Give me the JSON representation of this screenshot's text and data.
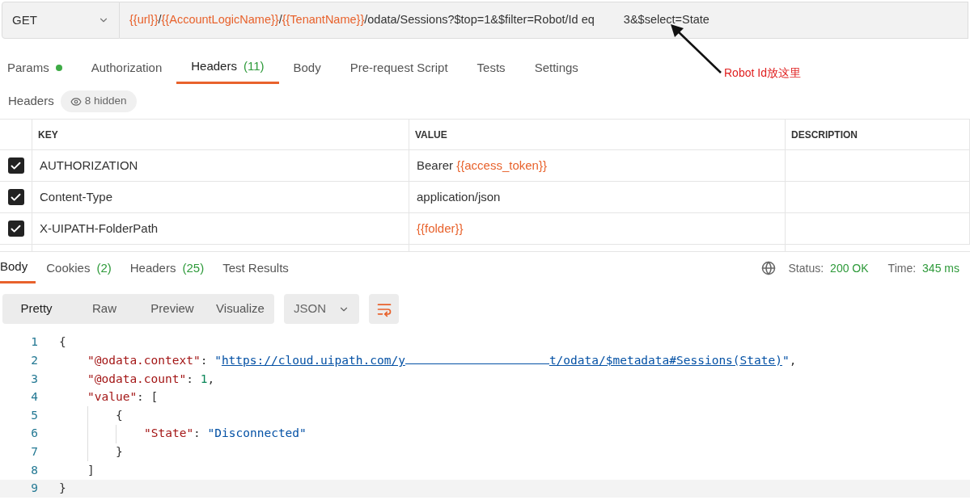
{
  "request": {
    "method": "GET",
    "url": [
      {
        "kind": "var",
        "text": "{{url}}"
      },
      {
        "kind": "text",
        "text": "/"
      },
      {
        "kind": "var",
        "text": "{{AccountLogicName}}"
      },
      {
        "kind": "text",
        "text": "/"
      },
      {
        "kind": "var",
        "text": "{{TenantName}}"
      },
      {
        "kind": "text",
        "text": "/odata/Sessions?$top=1&$filter=Robot/Id eq"
      },
      {
        "kind": "redacted"
      },
      {
        "kind": "text",
        "text": "3&$select=State"
      }
    ]
  },
  "annotation": {
    "text": "Robot Id放这里"
  },
  "request_tabs": [
    {
      "label": "Params",
      "dot": true,
      "selected": false
    },
    {
      "label": "Authorization",
      "selected": false
    },
    {
      "label": "Headers",
      "count": "(11)",
      "selected": true
    },
    {
      "label": "Body",
      "selected": false
    },
    {
      "label": "Pre-request Script",
      "selected": false
    },
    {
      "label": "Tests",
      "selected": false
    },
    {
      "label": "Settings",
      "selected": false
    }
  ],
  "headers_bar": {
    "title": "Headers",
    "hidden": "8 hidden"
  },
  "table": {
    "columns": [
      "KEY",
      "VALUE",
      "DESCRIPTION"
    ],
    "rows": [
      {
        "checked": true,
        "key": "AUTHORIZATION",
        "value": [
          {
            "kind": "text",
            "text": "Bearer "
          },
          {
            "kind": "var",
            "text": "{{access_token}}"
          }
        ]
      },
      {
        "checked": true,
        "key": "Content-Type",
        "value": [
          {
            "kind": "text",
            "text": "application/json"
          }
        ]
      },
      {
        "checked": true,
        "key": "X-UIPATH-FolderPath",
        "value": [
          {
            "kind": "var",
            "text": "{{folder}}"
          }
        ]
      }
    ]
  },
  "response_tabs": [
    {
      "label": "Body",
      "selected": true
    },
    {
      "label": "Cookies",
      "count": "(2)",
      "selected": false
    },
    {
      "label": "Headers",
      "count": "(25)",
      "selected": false
    },
    {
      "label": "Test Results",
      "selected": false
    }
  ],
  "status": {
    "status_label": "Status:",
    "status": "200 OK",
    "time_label": "Time:",
    "time": "345 ms"
  },
  "view_modes": [
    {
      "label": "Pretty",
      "selected": true
    },
    {
      "label": "Raw",
      "selected": false
    },
    {
      "label": "Preview",
      "selected": false
    },
    {
      "label": "Visualize",
      "selected": false
    }
  ],
  "format": "JSON",
  "code": [
    {
      "number": "1",
      "tokens": [
        {
          "kind": "punct",
          "text": "{"
        }
      ],
      "children": [
        {
          "number": "2",
          "tokens": [
            {
              "kind": "key",
              "text": "\"@odata.context\""
            },
            {
              "kind": "punct",
              "text": ": "
            },
            {
              "kind": "string",
              "text": "\""
            },
            {
              "kind": "link",
              "text": "https://cloud.uipath.com/y"
            },
            {
              "kind": "redacted_link"
            },
            {
              "kind": "link",
              "text": "t/odata/$metadata#Sessions(State)"
            },
            {
              "kind": "string",
              "text": "\""
            },
            {
              "kind": "punct",
              "text": ","
            }
          ]
        },
        {
          "number": "3",
          "tokens": [
            {
              "kind": "key",
              "text": "\"@odata.count\""
            },
            {
              "kind": "punct",
              "text": ": "
            },
            {
              "kind": "number",
              "text": "1"
            },
            {
              "kind": "punct",
              "text": ","
            }
          ]
        },
        {
          "number": "4",
          "tokens": [
            {
              "kind": "key",
              "text": "\"value\""
            },
            {
              "kind": "punct",
              "text": ": ["
            }
          ],
          "children": [
            {
              "number": "5",
              "tokens": [
                {
                  "kind": "punct",
                  "text": "{"
                }
              ],
              "children": [
                {
                  "number": "6",
                  "tokens": [
                    {
                      "kind": "key",
                      "text": "\"State\""
                    },
                    {
                      "kind": "punct",
                      "text": ": "
                    },
                    {
                      "kind": "string",
                      "text": "\"Disconnected\""
                    }
                  ]
                }
              ]
            },
            {
              "number": "7",
              "tokens": [
                {
                  "kind": "punct",
                  "text": "}"
                }
              ]
            }
          ]
        },
        {
          "number": "8",
          "tokens": [
            {
              "kind": "punct",
              "text": "]"
            }
          ]
        }
      ]
    },
    {
      "number": "9",
      "tokens": [
        {
          "kind": "punct",
          "text": "}"
        }
      ]
    }
  ]
}
